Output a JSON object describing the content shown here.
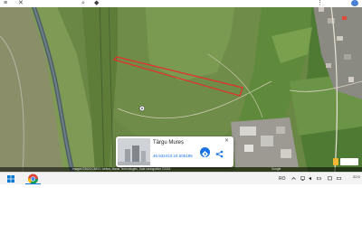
{
  "map": {
    "attribution": "Imagini ©2023 CNES / Airbus, Maxar Technologies, Date cartografice ©2023",
    "attribution_right": "Google",
    "highlight_color": "#e0332b"
  },
  "card": {
    "title": "Târgu Mureș",
    "coordinates": "46.532410,24.505185"
  },
  "taskbar": {
    "tray_label": "RO",
    "clock": "22:0",
    "accent": "#0078d4"
  }
}
